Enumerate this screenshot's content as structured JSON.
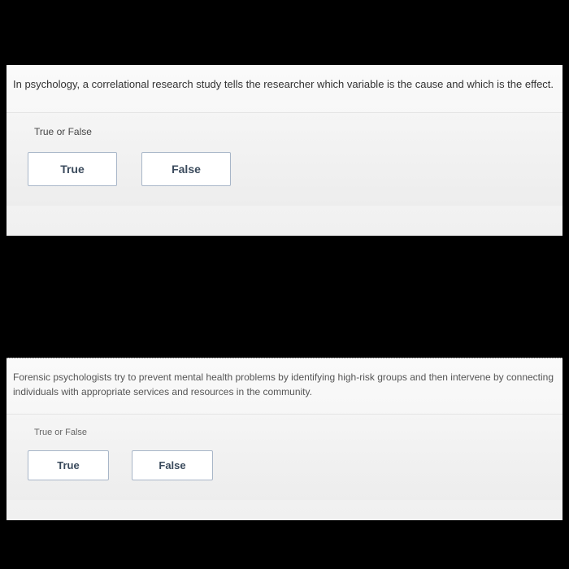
{
  "questions": [
    {
      "text": "In psychology, a correlational research study tells the researcher which variable is the cause and which is the effect.",
      "prompt": "True or False",
      "options": {
        "true_label": "True",
        "false_label": "False"
      }
    },
    {
      "text": "Forensic psychologists try to prevent mental health problems by identifying high-risk groups and then intervene by connecting individuals with appropriate services and resources in the community.",
      "prompt": "True or False",
      "options": {
        "true_label": "True",
        "false_label": "False"
      }
    }
  ]
}
